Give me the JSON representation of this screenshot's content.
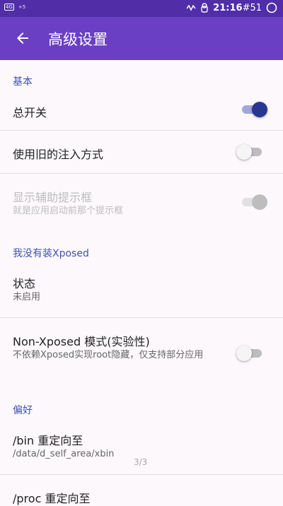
{
  "status_bar": {
    "left_badge": "4G",
    "left_small": "+5",
    "time": "21:16",
    "signal_text": "#51"
  },
  "app_bar": {
    "title": "高级设置"
  },
  "sections": {
    "basic": "基本",
    "no_xposed": "我没有装Xposed",
    "prefs": "偏好"
  },
  "rows": {
    "master_switch": {
      "title": "总开关",
      "on": true
    },
    "old_injection": {
      "title": "使用旧的注入方式",
      "on": false
    },
    "helper_prompt": {
      "title": "显示辅助提示框",
      "summary": "就是应用启动前那个提示框",
      "on": true,
      "enabled": false
    },
    "status": {
      "title": "状态",
      "summary": "未启用"
    },
    "non_xposed_mode": {
      "title": "Non-Xposed 模式(实验性)",
      "summary": "不依赖Xposed实现root隐藏，仅支持部分应用",
      "on": false
    },
    "bin_redirect": {
      "title": "/bin 重定向至",
      "summary": "/data/d_self_area/xbin"
    },
    "proc_redirect": {
      "title": "/proc 重定向至"
    }
  },
  "pager": "3/3",
  "colors": {
    "status_bar": "#512da8",
    "app_bar": "#6a3fc4",
    "accent": "#3f51b5",
    "switch_on": "#283593"
  }
}
